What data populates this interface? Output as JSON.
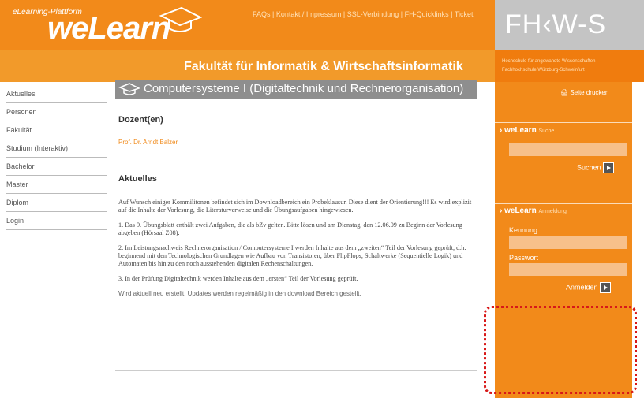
{
  "header": {
    "platform_label": "eLearning-Plattform",
    "logo": "weLearn",
    "links": [
      "FAQs",
      "Kontakt / Impressum",
      "SSL-Verbindung",
      "FH-Quicklinks",
      "Ticket"
    ],
    "link_separator": " | ",
    "faculty": "Fakultät für Informatik & Wirtschaftsinformatik",
    "fhws_logo": "FH‹W-S",
    "fhws_subtitle_1": "Hochschule für angewandte Wissenschaften",
    "fhws_subtitle_2": "Fachhochschule Würzburg-Schweinfurt"
  },
  "nav": {
    "items": [
      "Aktuelles",
      "Personen",
      "Fakultät",
      "Studium (Interaktiv)",
      "Bachelor",
      "Master",
      "Diplom",
      "Login"
    ]
  },
  "main": {
    "title": "Computersysteme I (Digitaltechnik und Rechnerorganisation)",
    "dozenten_heading": "Dozent(en)",
    "dozent_name": "Prof. Dr. Arndt Balzer",
    "aktuelles_heading": "Aktuelles",
    "paragraphs": [
      "Auf Wunsch einiger Kommilitonen befindet sich im Downloadbereich ein Probeklausur. Diese dient der Orientierung!!! Es wird explizit auf die Inhalte der Vorlesung, die Literaturverweise und die Übungsaufgaben hingewiesen.",
      "1. Das 9. Übungsblatt enthält zwei Aufgaben, die als bZv gelten. Bitte lösen und am Dienstag, den 12.06.09 zu Beginn der Vorlesung abgeben (Hörsaal Z08).",
      "2. Im Leistungsnachweis Rechnerorganisation / Computersysteme I werden Inhalte aus dem „zweiten“ Teil der Vorlesung geprüft, d.h. beginnend mit den Technologischen Grundlagen wie Aufbau von Transistoren, über FlipFlops, Schaltwerke (Sequentielle Logik) und Automaten bis hin zu den noch ausstehenden digitalen Rechenschaltungen.",
      "3. In der Prüfung Digitaltechnik werden Inhalte aus dem „ersten“ Teil der Vorlesung geprüft."
    ],
    "updates_note": "Wird aktuell neu erstellt. Updates werden regelmäßig in den download Bereich gestellt."
  },
  "sidebar": {
    "print_label": "Seite drucken",
    "search_brand": "weLearn",
    "search_title": "Suche",
    "search_button": "Suchen",
    "login_brand": "weLearn",
    "login_title": "Anmeldung",
    "kennung_label": "Kennung",
    "passwort_label": "Passwort",
    "login_button": "Anmelden"
  },
  "colors": {
    "orange": "#f28a1a",
    "grey_title": "#8e8e8e",
    "highlight": "#d81818"
  }
}
